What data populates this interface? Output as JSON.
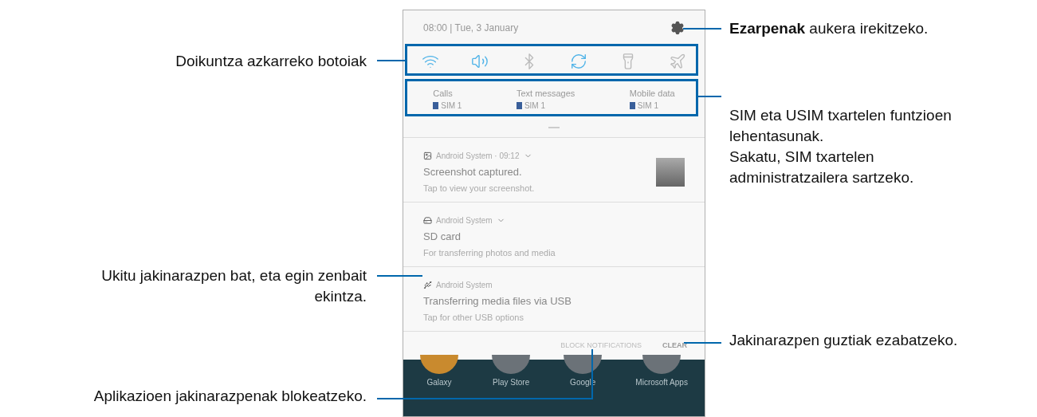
{
  "phone": {
    "status": {
      "time_date": "08:00 | Tue, 3 January"
    },
    "quick_buttons": [
      {
        "kind": "wifi",
        "on": true
      },
      {
        "kind": "sound",
        "on": true
      },
      {
        "kind": "bluetooth",
        "on": false
      },
      {
        "kind": "rotate",
        "on": true
      },
      {
        "kind": "flashlight",
        "on": false
      },
      {
        "kind": "airplane",
        "on": false
      }
    ],
    "sim_preferences": [
      {
        "label": "Calls",
        "sim": "SIM 1"
      },
      {
        "label": "Text messages",
        "sim": "SIM 1"
      },
      {
        "label": "Mobile data",
        "sim": "SIM 1"
      }
    ],
    "notifications": [
      {
        "kind": "image",
        "app": "Android System · 09:12",
        "expandable": true,
        "title": "Screenshot captured.",
        "text": "Tap to view your screenshot.",
        "thumbnail": true
      },
      {
        "kind": "sd",
        "app": "Android System",
        "expandable": true,
        "title": "SD card",
        "text": "For transferring photos and media",
        "thumbnail": false
      },
      {
        "kind": "usb",
        "app": "Android System",
        "expandable": false,
        "title": "Transferring media files via USB",
        "text": "Tap for other USB options",
        "thumbnail": false
      }
    ],
    "footer": {
      "block": "BLOCK NOTIFICATIONS",
      "clear": "CLEAR"
    },
    "dock": [
      {
        "label": "Galaxy",
        "color": "#c98a2e"
      },
      {
        "label": "Play Store",
        "color": "#6b7278"
      },
      {
        "label": "Google",
        "color": "#6b7278"
      },
      {
        "label": "Microsoft Apps",
        "color": "#6b7278"
      }
    ]
  },
  "callouts": [
    {
      "lines": [
        "Doikuntza azkarreko botoiak"
      ]
    },
    {
      "lines": [
        "Ukitu jakinarazpen bat, eta egin zenbait",
        "ekintza."
      ]
    },
    {
      "lines": [
        "Aplikazioen jakinarazpenak blokeatzeko."
      ]
    },
    {
      "lines": [
        "**Ezarpenak** aukera irekitzeko."
      ]
    },
    {
      "lines": [
        "SIM eta USIM txartelen funtzioen",
        "lehentasunak.",
        "Sakatu, SIM txartelen",
        "administratzailera sartzeko."
      ]
    },
    {
      "lines": [
        "Jakinarazpen guztiak ezabatzeko."
      ]
    }
  ]
}
